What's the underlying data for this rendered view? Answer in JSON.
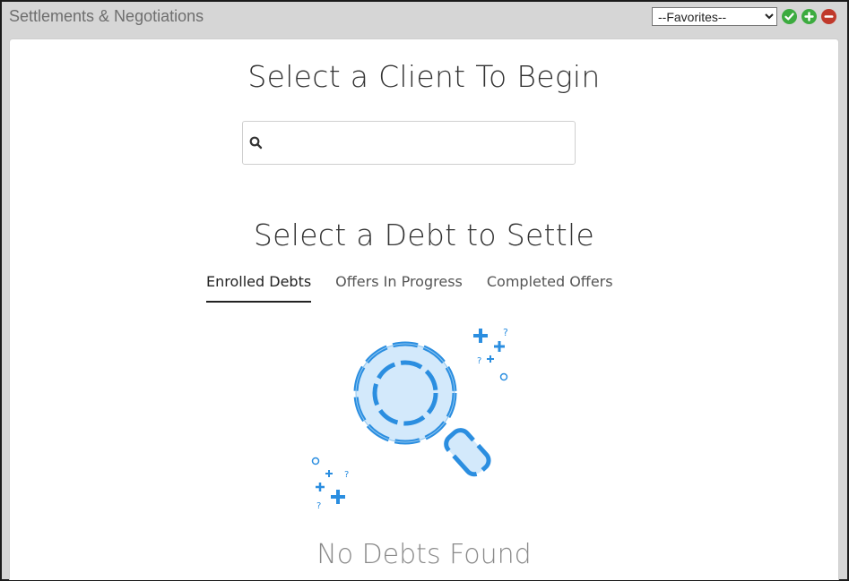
{
  "window": {
    "title": "Settlements & Negotiations",
    "favorites": {
      "selected": "--Favorites--",
      "options": [
        "--Favorites--"
      ]
    },
    "icons": [
      "check-icon",
      "plus-icon",
      "minus-icon"
    ],
    "colors": {
      "check": "#3cab3f",
      "plus": "#3cab3f",
      "minus": "#c0392b"
    }
  },
  "client": {
    "heading": "Select a Client To Begin",
    "search": {
      "value": "",
      "placeholder": ""
    }
  },
  "debt": {
    "heading": "Select a Debt to Settle",
    "tabs": [
      {
        "label": "Enrolled Debts",
        "active": true
      },
      {
        "label": "Offers In Progress",
        "active": false
      },
      {
        "label": "Completed Offers",
        "active": false
      }
    ],
    "empty_message": "No Debts Found",
    "illustration": "magnifying-glass-icon",
    "accent_color": "#2b8ee0"
  }
}
